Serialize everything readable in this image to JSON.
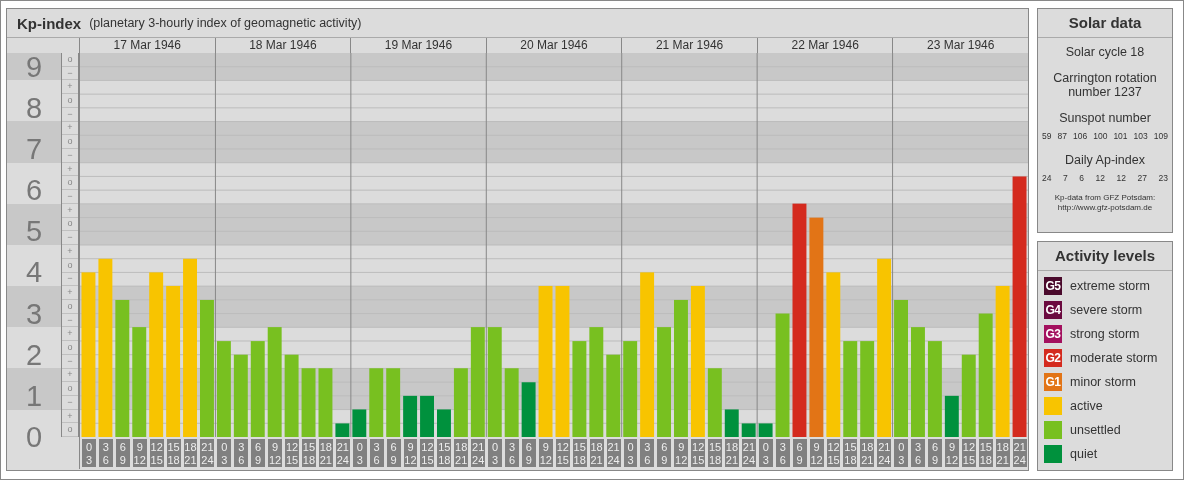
{
  "kp_panel": {
    "title": "Kp-index",
    "subtitle": "(planetary 3-hourly index of geomagnetic activity)",
    "days": [
      "17 Mar 1946",
      "18 Mar 1946",
      "19 Mar 1946",
      "20 Mar 1946",
      "21 Mar 1946",
      "22 Mar 1946",
      "23 Mar 1946"
    ],
    "scale_marks": [
      "o",
      "−",
      "+",
      "o",
      "−",
      "+",
      "o",
      "−",
      "+",
      "o",
      "−",
      "+",
      "o",
      "−",
      "+",
      "o",
      "−",
      "+",
      "o",
      "−",
      "+",
      "o",
      "−",
      "+",
      "o",
      "−",
      "+",
      "o"
    ],
    "chart_data": {
      "type": "bar",
      "stacked": true,
      "grid": true,
      "ylim": [
        0,
        9.33
      ],
      "yticks": [
        {
          "value": 9,
          "label": "9"
        },
        {
          "value": 8,
          "label": "8"
        },
        {
          "value": 7,
          "label": "7"
        },
        {
          "value": 6,
          "label": "6"
        },
        {
          "value": 5,
          "label": "5"
        },
        {
          "value": 4,
          "label": "4"
        },
        {
          "value": 3,
          "label": "3"
        },
        {
          "value": 2,
          "label": "2"
        },
        {
          "value": 1,
          "label": "1"
        },
        {
          "value": 0,
          "label": "0"
        }
      ],
      "categories": [
        "0 3",
        "3 6",
        "6 9",
        "9 12",
        "12 15",
        "15 18",
        "18 21",
        "21 24",
        "0 3",
        "3 6",
        "6 9",
        "9 12",
        "12 15",
        "15 18",
        "18 21",
        "21 24",
        "0 3",
        "3 6",
        "6 9",
        "9 12",
        "12 15",
        "15 18",
        "18 21",
        "21 24",
        "0 3",
        "3 6",
        "6 9",
        "9 12",
        "12 15",
        "15 18",
        "18 21",
        "21 24",
        "0 3",
        "3 6",
        "6 9",
        "9 12",
        "12 15",
        "15 18",
        "18 21",
        "21 24",
        "0 3",
        "3 6",
        "6 9",
        "9 12",
        "12 15",
        "15 18",
        "18 21",
        "21 24",
        "0 3",
        "3 6",
        "6 9",
        "9 12",
        "12 15",
        "15 18",
        "18 21",
        "21 24"
      ],
      "series": [
        {
          "color": "#d42a1e",
          "values": [
            null,
            null,
            null,
            null,
            null,
            null,
            null,
            null,
            null,
            null,
            null,
            null,
            null,
            null,
            null,
            null,
            null,
            null,
            null,
            null,
            null,
            null,
            null,
            null,
            null,
            null,
            null,
            null,
            null,
            null,
            null,
            null,
            null,
            null,
            null,
            null,
            null,
            null,
            null,
            null,
            null,
            null,
            5.67,
            null,
            null,
            null,
            null,
            null,
            null,
            null,
            null,
            null,
            null,
            null,
            null,
            6.33
          ]
        },
        {
          "color": "#e27416",
          "values": [
            null,
            null,
            null,
            null,
            null,
            null,
            null,
            null,
            null,
            null,
            null,
            null,
            null,
            null,
            null,
            null,
            null,
            null,
            null,
            null,
            null,
            null,
            null,
            null,
            null,
            null,
            null,
            null,
            null,
            null,
            null,
            null,
            null,
            null,
            null,
            null,
            null,
            null,
            null,
            null,
            null,
            null,
            null,
            5.33,
            null,
            null,
            null,
            null,
            null,
            null,
            null,
            null,
            null,
            null,
            null,
            null
          ]
        },
        {
          "color": "#f8c400",
          "values": [
            4,
            4.33,
            null,
            null,
            4,
            3.67,
            4.33,
            null,
            null,
            null,
            null,
            null,
            null,
            null,
            null,
            null,
            null,
            null,
            null,
            null,
            null,
            null,
            null,
            null,
            null,
            null,
            null,
            3.67,
            3.67,
            null,
            null,
            null,
            null,
            4,
            null,
            null,
            3.67,
            null,
            null,
            null,
            null,
            null,
            null,
            null,
            4,
            null,
            null,
            4.33,
            null,
            null,
            null,
            null,
            null,
            null,
            3.67,
            null
          ]
        },
        {
          "color": "#78c020",
          "values": [
            null,
            null,
            3.33,
            2.67,
            null,
            null,
            null,
            3.33,
            2.33,
            2,
            2.33,
            2.67,
            2,
            1.67,
            1.67,
            null,
            null,
            1.67,
            1.67,
            null,
            null,
            null,
            1.67,
            2.67,
            2.67,
            1.67,
            null,
            null,
            null,
            2.33,
            2.67,
            2,
            2.33,
            null,
            2.67,
            3.33,
            null,
            1.67,
            null,
            null,
            null,
            3,
            null,
            null,
            null,
            2.33,
            2.33,
            null,
            3.33,
            2.67,
            2.33,
            null,
            2,
            3,
            null,
            null
          ]
        },
        {
          "color": "#00913d",
          "values": [
            null,
            null,
            null,
            null,
            null,
            null,
            null,
            null,
            null,
            null,
            null,
            null,
            null,
            null,
            null,
            0.33,
            0.67,
            null,
            null,
            1,
            1,
            0.67,
            null,
            null,
            null,
            null,
            1.33,
            null,
            null,
            null,
            null,
            null,
            null,
            null,
            null,
            null,
            null,
            null,
            0.67,
            0.33,
            0.33,
            null,
            null,
            null,
            null,
            null,
            null,
            null,
            null,
            null,
            null,
            1,
            null,
            null,
            null,
            null
          ]
        }
      ]
    }
  },
  "solar_data": {
    "title": "Solar data",
    "solar_cycle": "Solar cycle 18",
    "carrington": "Carrington rotation number 1237",
    "sunspot_heading": "Sunspot number",
    "sunspot_numbers": [
      "59",
      "87",
      "106",
      "100",
      "101",
      "103",
      "109"
    ],
    "ap_heading": "Daily Ap-index",
    "ap_values": [
      "24",
      "7",
      "6",
      "12",
      "12",
      "27",
      "23"
    ],
    "source": [
      "Kp-data from GFZ Potsdam:",
      "http://www.gfz-potsdam.de"
    ]
  },
  "legend": {
    "title": "Activity levels",
    "items": [
      {
        "badge": "G5",
        "label": "extreme storm",
        "color": "#4a0a2c"
      },
      {
        "badge": "G4",
        "label": "severe storm",
        "color": "#6b0a3f"
      },
      {
        "badge": "G3",
        "label": "strong storm",
        "color": "#a3105e"
      },
      {
        "badge": "G2",
        "label": "moderate storm",
        "color": "#d42a1e"
      },
      {
        "badge": "G1",
        "label": "minor storm",
        "color": "#e27416"
      },
      {
        "label": "active",
        "color": "#f8c400"
      },
      {
        "label": "unsettled",
        "color": "#78c020"
      },
      {
        "label": "quiet",
        "color": "#00913d"
      }
    ]
  }
}
